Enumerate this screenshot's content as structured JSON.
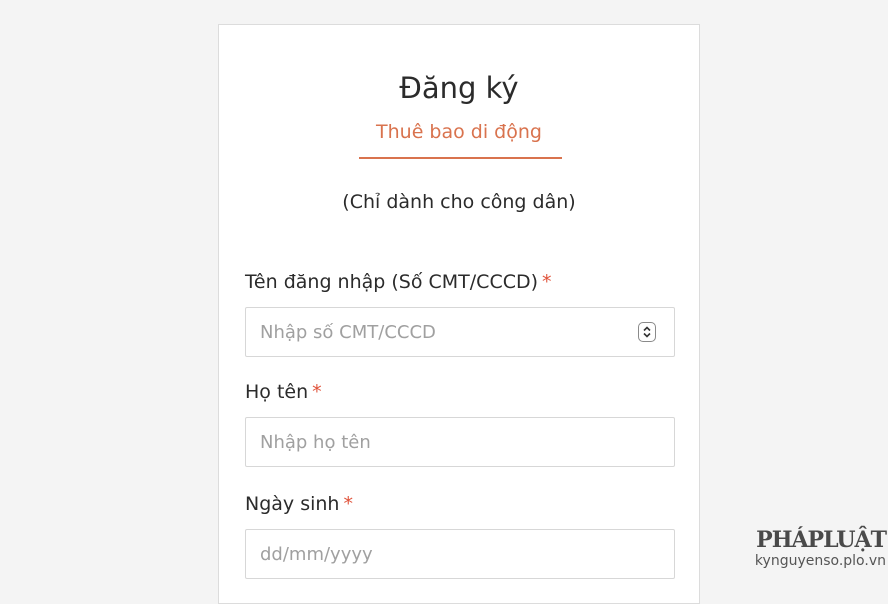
{
  "form": {
    "title": "Đăng ký",
    "tab_label": "Thuê bao di động",
    "note": "(Chỉ dành cho công dân)",
    "required_mark": "*",
    "fields": [
      {
        "label": "Tên đăng nhập (Số CMT/CCCD)",
        "placeholder": "Nhập số CMT/CCCD",
        "value": ""
      },
      {
        "label": "Họ tên",
        "placeholder": "Nhập họ tên",
        "value": ""
      },
      {
        "label": "Ngày sinh",
        "placeholder": "dd/mm/yyyy",
        "value": ""
      }
    ]
  },
  "watermark": {
    "logo_text": "PHÁPLUẬT",
    "url": "kynguyenso.plo.vn"
  },
  "colors": {
    "accent": "#d9734e",
    "required": "#e0523a",
    "placeholder": "#a0a0a0",
    "border": "#d7d7d7"
  },
  "icons": {
    "stepper": "up-down-chevron-icon"
  }
}
